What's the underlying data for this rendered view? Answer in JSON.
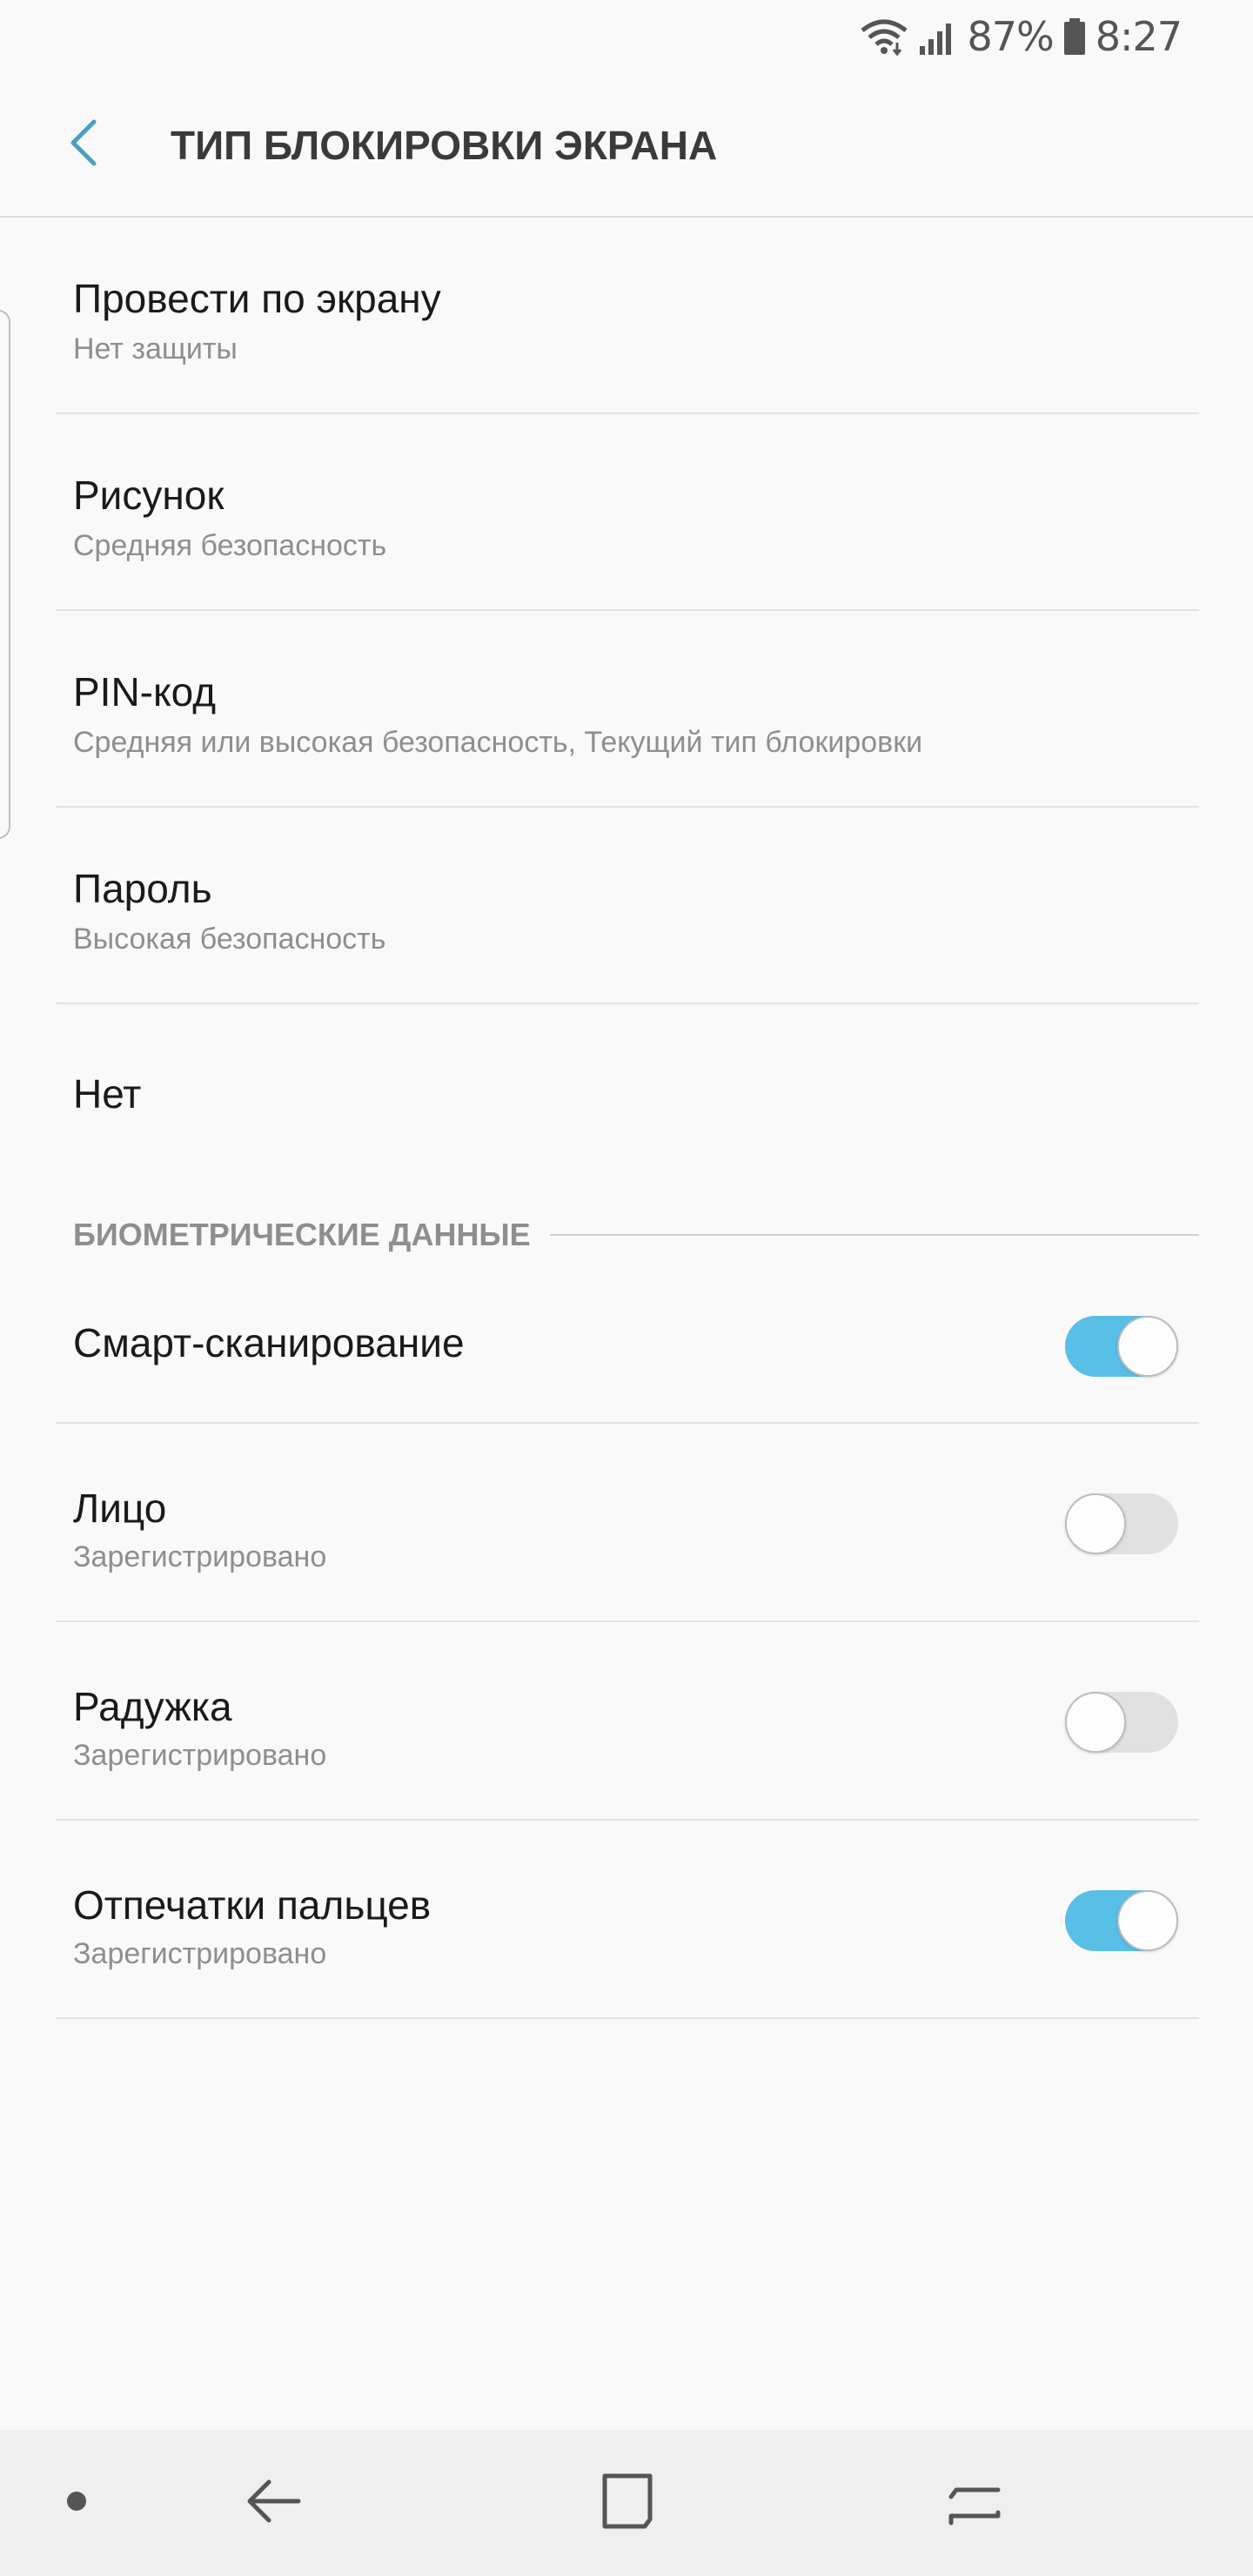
{
  "status_bar": {
    "battery_percent": "87%",
    "time": "8:27",
    "icons": [
      "wifi-icon",
      "signal-icon",
      "battery-icon"
    ]
  },
  "app_bar": {
    "title": "ТИП БЛОКИРОВКИ ЭКРАНА",
    "back_icon": "back-arrow-icon"
  },
  "lock_types": [
    {
      "title": "Провести по экрану",
      "subtitle": "Нет защиты"
    },
    {
      "title": "Рисунок",
      "subtitle": "Средняя безопасность"
    },
    {
      "title": "PIN-код",
      "subtitle": "Средняя или высокая безопасность, Текущий тип блокировки"
    },
    {
      "title": "Пароль",
      "subtitle": "Высокая безопасность"
    },
    {
      "title": "Нет"
    }
  ],
  "biometrics": {
    "header": "БИОМЕТРИЧЕСКИЕ ДАННЫЕ",
    "items": [
      {
        "title": "Смарт-сканирование",
        "enabled": true
      },
      {
        "title": "Лицо",
        "subtitle": "Зарегистрировано",
        "enabled": false
      },
      {
        "title": "Радужка",
        "subtitle": "Зарегистрировано",
        "enabled": false
      },
      {
        "title": "Отпечатки пальцев",
        "subtitle": "Зарегистрировано",
        "enabled": true
      }
    ]
  },
  "nav_bar": {
    "buttons": [
      "dot-icon",
      "back-icon",
      "home-icon",
      "recents-icon"
    ]
  },
  "colors": {
    "accent": "#58bfe6",
    "background": "#f9f9f9",
    "subtitle": "#8e8e8e",
    "back_arrow": "#4a9fc2"
  }
}
